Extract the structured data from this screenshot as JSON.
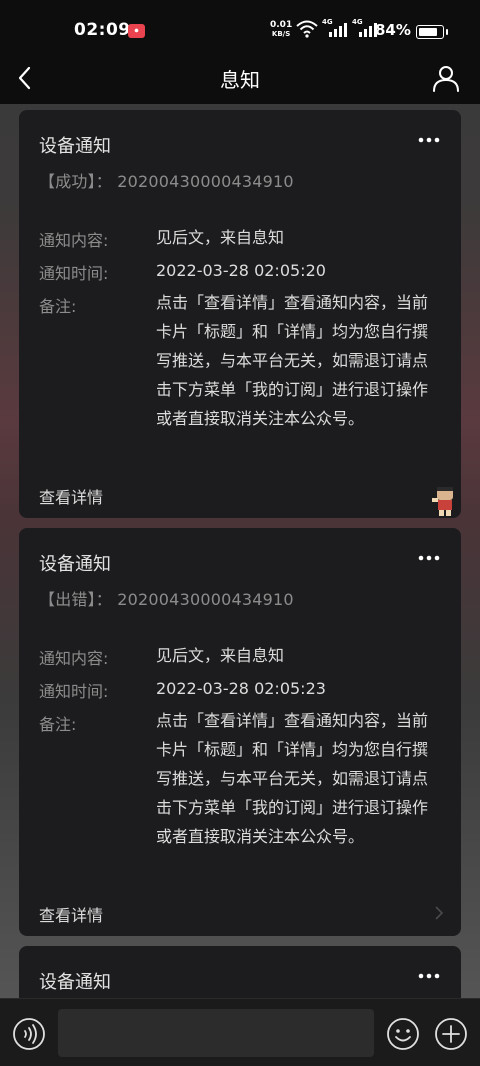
{
  "status_bar": {
    "time": "02:09",
    "rec_label": "⏺",
    "net_speed": "0.01",
    "net_unit": "KB/S",
    "signal1_label": "4G",
    "signal2_label": "4G",
    "battery_pct": "84%"
  },
  "nav": {
    "title": "息知"
  },
  "cards": [
    {
      "title": "设备通知",
      "status": "【成功】：  20200430000434910",
      "content_label": "通知内容:",
      "content_value": "见后文，来自息知",
      "time_label": "通知时间:",
      "time_value": "2022-03-28 02:05:20",
      "remark_label": "备注:",
      "remark_value": "点击「查看详情」查看通知内容，当前卡片「标题」和「详情」均为您自行撰写推送，与本平台无关，如需退订请点击下方菜单「我的订阅」进行退订操作或者直接取消关注本公众号。",
      "footer_label": "查看详情"
    },
    {
      "title": "设备通知",
      "status": "【出错】：  20200430000434910",
      "content_label": "通知内容:",
      "content_value": "见后文，来自息知",
      "time_label": "通知时间:",
      "time_value": "2022-03-28 02:05:23",
      "remark_label": "备注:",
      "remark_value": "点击「查看详情」查看通知内容，当前卡片「标题」和「详情」均为您自行撰写推送，与本平台无关，如需退订请点击下方菜单「我的订阅」进行退订操作或者直接取消关注本公众号。",
      "footer_label": "查看详情"
    },
    {
      "title": "设备通知"
    }
  ],
  "input": {
    "value": ""
  },
  "icons": {
    "back": "chevron-left-icon",
    "profile": "user-icon",
    "more": "more-dots-icon",
    "voice": "voice-icon",
    "emoji": "emoji-icon",
    "plus": "plus-icon"
  }
}
